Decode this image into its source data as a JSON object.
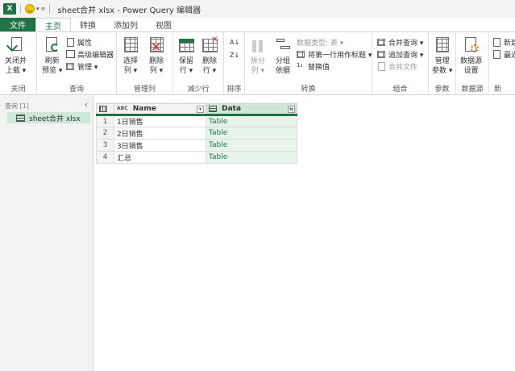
{
  "titlebar": {
    "app_icon": "X",
    "title": "sheet合并 xlsx - Power Query 编辑器"
  },
  "tabs": [
    {
      "label": "文件"
    },
    {
      "label": "主页"
    },
    {
      "label": "转换"
    },
    {
      "label": "添加列"
    },
    {
      "label": "视图"
    }
  ],
  "ribbon": {
    "close": {
      "label1": "关闭并",
      "label2": "上载 ▾",
      "group": "关闭"
    },
    "query": {
      "refresh1": "刷新",
      "refresh2": "预览 ▾",
      "properties": "属性",
      "advanced_editor": "高级编辑器",
      "manage": "管理 ▾",
      "group": "查询"
    },
    "manage_cols": {
      "choose1": "选择",
      "choose2": "列 ▾",
      "remove1": "删除",
      "remove2": "列 ▾",
      "group": "管理列"
    },
    "reduce_rows": {
      "keep1": "保留",
      "keep2": "行 ▾",
      "remove1": "删除",
      "remove2": "行 ▾",
      "group": "减少行"
    },
    "sort": {
      "group": "排序"
    },
    "transform": {
      "split1": "拆分",
      "split2": "列 ▾",
      "groupby1": "分组",
      "groupby2": "依据",
      "datatype": "数据类型: 表 ▾",
      "first_row_header": "将第一行用作标题 ▾",
      "replace_values": "替换值",
      "group": "转换"
    },
    "combine": {
      "merge_queries": "合并查询 ▾",
      "append_queries": "追加查询 ▾",
      "combine_files": "合并文件",
      "group": "组合"
    },
    "params": {
      "manage1": "管理",
      "manage2": "参数 ▾",
      "group": "参数"
    },
    "datasource": {
      "settings1": "数据源",
      "settings2": "设置",
      "group": "数据源"
    },
    "newquery": {
      "new_source": "新建",
      "recent_source": "最近",
      "group": "新"
    }
  },
  "left_nav": {
    "header": "查询 [1]",
    "queries": [
      {
        "name": "sheet合并 xlsx"
      }
    ]
  },
  "grid": {
    "columns": [
      {
        "type_icon": "ABC",
        "name": "Name"
      },
      {
        "type_icon": "table-icon",
        "name": "Data"
      }
    ],
    "rows": [
      {
        "num": "1",
        "name": "1日销售",
        "data": "Table"
      },
      {
        "num": "2",
        "name": "2日销售",
        "data": "Table"
      },
      {
        "num": "3",
        "name": "3日销售",
        "data": "Table"
      },
      {
        "num": "4",
        "name": "汇总",
        "data": "Table"
      }
    ]
  },
  "colors": {
    "accent": "#217346",
    "selected_col": "#cde8d9"
  }
}
